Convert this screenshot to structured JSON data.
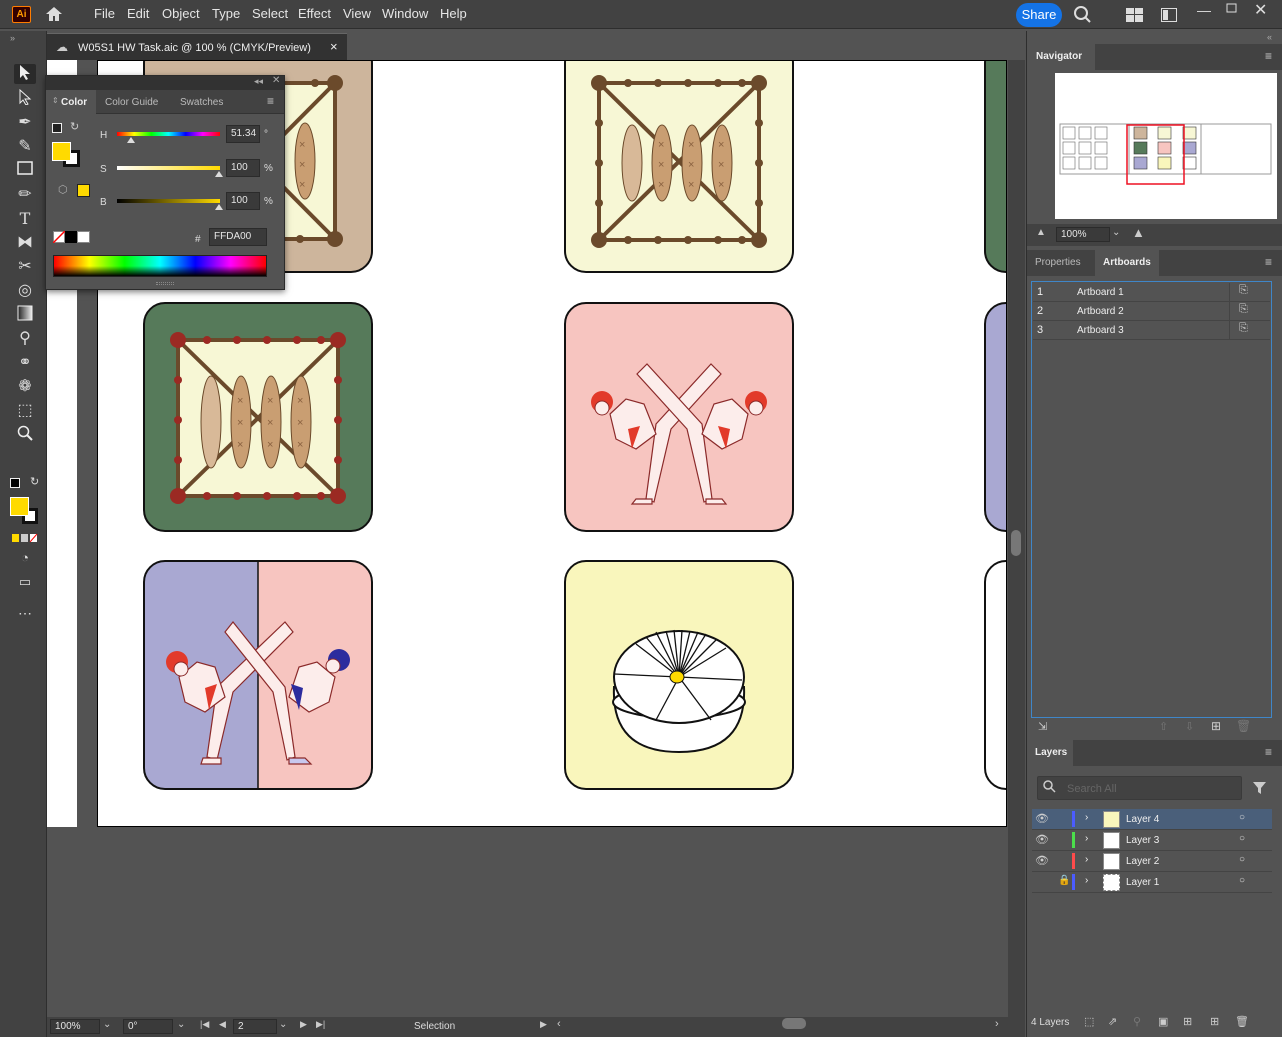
{
  "app": {
    "logo_text": "Ai"
  },
  "menu": [
    "File",
    "Edit",
    "Object",
    "Type",
    "Select",
    "Effect",
    "View",
    "Window",
    "Help"
  ],
  "share_label": "Share",
  "document_tab": {
    "title": "W05S1 HW Task.aic @ 100 % (CMYK/Preview)",
    "close": "×"
  },
  "color_panel": {
    "tabs": [
      "Color",
      "Color Guide",
      "Swatches"
    ],
    "h_label": "H",
    "h_value": "51.34",
    "h_unit": "°",
    "s_label": "S",
    "s_value": "100",
    "s_unit": "%",
    "b_label": "B",
    "b_value": "100",
    "b_unit": "%",
    "hex_label": "#",
    "hex_value": "FFDA00",
    "h_level": 0.143,
    "s_level": 1.0,
    "b_level": 1.0,
    "fill_color": "#FFDA00"
  },
  "navigator": {
    "title": "Navigator",
    "zoom": "100%"
  },
  "artboards_panel": {
    "tabs": [
      "Properties",
      "Artboards"
    ],
    "rows": [
      {
        "num": "1",
        "name": "Artboard 1"
      },
      {
        "num": "2",
        "name": "Artboard 2"
      },
      {
        "num": "3",
        "name": "Artboard 3"
      }
    ]
  },
  "layers_panel": {
    "title": "Layers",
    "search_placeholder": "Search All",
    "rows": [
      {
        "name": "Layer 4",
        "color": "#4b5cff",
        "visible": true,
        "locked": false
      },
      {
        "name": "Layer 3",
        "color": "#4bde4b",
        "visible": true,
        "locked": false
      },
      {
        "name": "Layer 2",
        "color": "#ff4b4b",
        "visible": true,
        "locked": false
      },
      {
        "name": "Layer 1",
        "color": "#4b5cff",
        "visible": false,
        "locked": true
      }
    ],
    "count": "4 Layers"
  },
  "status_bar": {
    "zoom": "100%",
    "rotate": "0°",
    "artboard_num": "2",
    "tool": "Selection"
  },
  "colors": {
    "tan": "#CDB59C",
    "cream": "#F7F7D5",
    "green": "#567A5A",
    "pink": "#F7C5C0",
    "lavender": "#A9A8D2",
    "yellow": "#F9F6BC",
    "brown": "#6B4A2B",
    "dark_red": "#9B2A23",
    "red": "#E23A2A",
    "blue": "#2C2C9E"
  }
}
